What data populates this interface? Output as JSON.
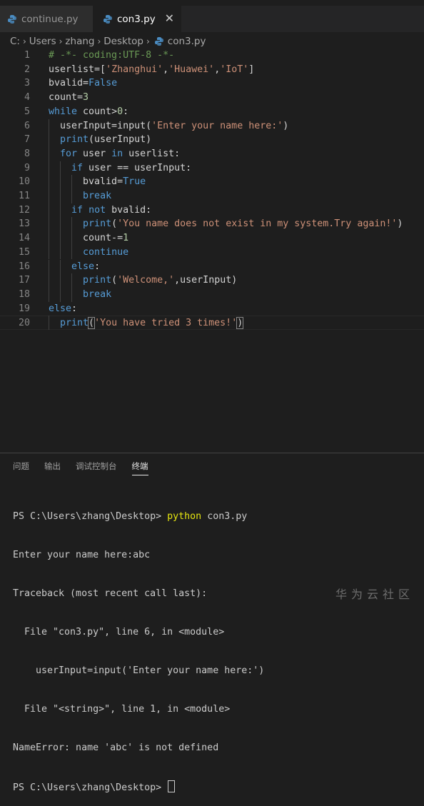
{
  "tabs": [
    {
      "label": "continue.py",
      "icon": "python-icon"
    },
    {
      "label": "con3.py",
      "icon": "python-icon",
      "close": "✕"
    }
  ],
  "breadcrumb": [
    "C:",
    "Users",
    "zhang",
    "Desktop",
    "con3.py"
  ],
  "code_lines": [
    {
      "n": "1",
      "text": "# -*- coding:UTF-8 -*-"
    },
    {
      "n": "2",
      "text": "userlist=['Zhanghui','Huawei','IoT']"
    },
    {
      "n": "3",
      "text": "bvalid=False"
    },
    {
      "n": "4",
      "text": "count=3"
    },
    {
      "n": "5",
      "text": "while count>0:"
    },
    {
      "n": "6",
      "text": "  userInput=input('Enter your name here:')"
    },
    {
      "n": "7",
      "text": "  print(userInput)"
    },
    {
      "n": "8",
      "text": "  for user in userlist:"
    },
    {
      "n": "9",
      "text": "    if user == userInput:"
    },
    {
      "n": "10",
      "text": "      bvalid=True"
    },
    {
      "n": "11",
      "text": "      break"
    },
    {
      "n": "12",
      "text": "    if not bvalid:"
    },
    {
      "n": "13",
      "text": "      print('You name does not exist in my system.Try again!')"
    },
    {
      "n": "14",
      "text": "      count-=1"
    },
    {
      "n": "15",
      "text": "      continue"
    },
    {
      "n": "16",
      "text": "    else:"
    },
    {
      "n": "17",
      "text": "      print('Welcome,',userInput)"
    },
    {
      "n": "18",
      "text": "      break"
    },
    {
      "n": "19",
      "text": "else:"
    },
    {
      "n": "20",
      "text": "  print('You have tried 3 times!')"
    }
  ],
  "panel_tabs": [
    "问题",
    "输出",
    "调试控制台",
    "终端"
  ],
  "terminal": {
    "prompt": "PS C:\\Users\\zhang\\Desktop>",
    "command": "python",
    "arg": "con3.py",
    "lines": [
      "Enter your name here:abc",
      "Traceback (most recent call last):",
      "  File \"con3.py\", line 6, in <module>",
      "    userInput=input('Enter your name here:')",
      "  File \"<string>\", line 1, in <module>",
      "NameError: name 'abc' is not defined"
    ],
    "final_prompt": "PS C:\\Users\\zhang\\Desktop>"
  },
  "watermark": "华为云社区",
  "colors": {
    "keyword": "#569cd6",
    "string": "#ce9178",
    "number": "#b5cea8",
    "comment": "#6a9955",
    "python_cmd": "#e5e510"
  }
}
